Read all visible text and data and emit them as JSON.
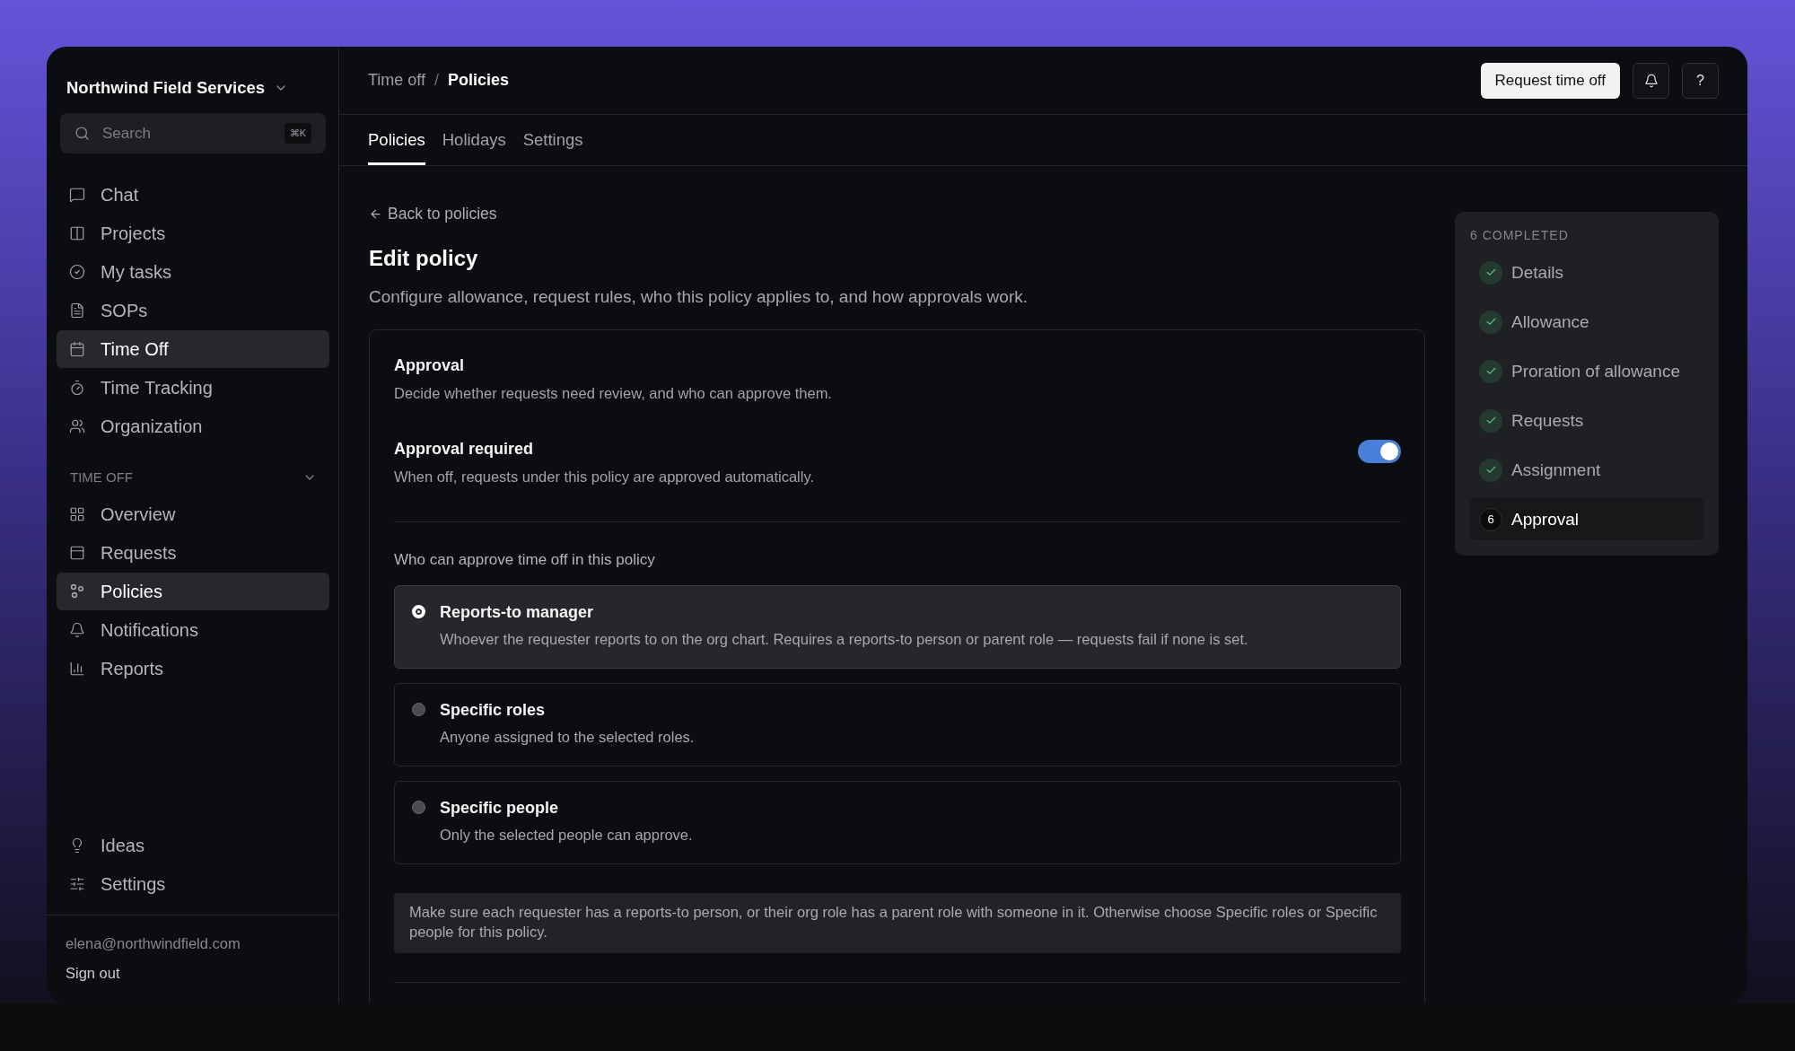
{
  "sidebar": {
    "org_name": "Northwind Field Services",
    "search": {
      "placeholder": "Search",
      "shortcut": "⌘K"
    },
    "nav": [
      {
        "label": "Chat",
        "selected": false
      },
      {
        "label": "Projects",
        "selected": false
      },
      {
        "label": "My tasks",
        "selected": false
      },
      {
        "label": "SOPs",
        "selected": false
      },
      {
        "label": "Time Off",
        "selected": true
      },
      {
        "label": "Time Tracking",
        "selected": false
      },
      {
        "label": "Organization",
        "selected": false
      }
    ],
    "section": {
      "title": "TIME OFF",
      "expanded": true,
      "items": [
        {
          "label": "Overview",
          "selected": false
        },
        {
          "label": "Requests",
          "selected": false
        },
        {
          "label": "Policies",
          "selected": true
        },
        {
          "label": "Notifications",
          "selected": false
        },
        {
          "label": "Reports",
          "selected": false
        }
      ]
    },
    "bottom_nav": [
      {
        "label": "Ideas",
        "selected": false
      },
      {
        "label": "Settings",
        "selected": false
      }
    ],
    "user_email": "elena@northwindfield.com",
    "sign_out": "Sign out"
  },
  "header": {
    "breadcrumb": [
      "Time off",
      "Policies"
    ],
    "breadcrumb_separator": "/",
    "primary_button": "Request time off",
    "help_button": "?"
  },
  "tabs": [
    {
      "label": "Policies",
      "selected": true
    },
    {
      "label": "Holidays",
      "selected": false
    },
    {
      "label": "Settings",
      "selected": false
    }
  ],
  "back_link": "Back to policies",
  "title": "Edit policy",
  "description": "Configure allowance, request rules, who this policy applies to, and how approvals work.",
  "card": {
    "title": "Approval",
    "subtitle": "Decide whether requests need review, and who can approve them.",
    "toggle": {
      "label": "Approval required",
      "hint": "When off, requests under this policy are approved automatically.",
      "on": true
    },
    "question": "Who can approve time off in this policy",
    "options": [
      {
        "title": "Reports-to manager",
        "description": "Whoever the requester reports to on the org chart. Requires a reports-to person or parent role — requests fail if none is set.",
        "selected": true
      },
      {
        "title": "Specific roles",
        "description": "Anyone assigned to the selected roles.",
        "selected": false
      },
      {
        "title": "Specific people",
        "description": "Only the selected people can approve.",
        "selected": false
      }
    ],
    "note": "Make sure each requester has a reports-to person, or their org role has a parent role with someone in it. Otherwise choose Specific roles or Specific people for this policy."
  },
  "progress": {
    "heading": "6 COMPLETED",
    "steps": [
      {
        "label": "Details",
        "kind": "done",
        "selected": false
      },
      {
        "label": "Allowance",
        "kind": "done",
        "selected": false
      },
      {
        "label": "Proration of allowance",
        "kind": "done",
        "selected": false
      },
      {
        "label": "Requests",
        "kind": "done",
        "selected": false
      },
      {
        "label": "Assignment",
        "kind": "done",
        "selected": false
      },
      {
        "label": "Approval",
        "kind": "current",
        "number": "6",
        "selected": true
      }
    ]
  }
}
